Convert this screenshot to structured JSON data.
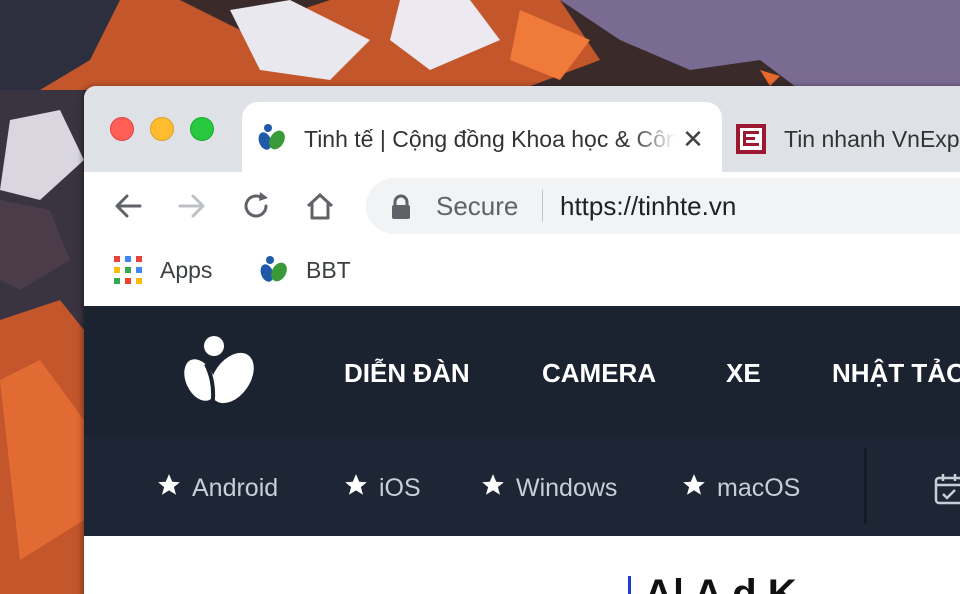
{
  "window": {
    "controls": [
      "close",
      "minimize",
      "maximize"
    ]
  },
  "tabs": [
    {
      "title": "Tinh tế | Cộng đồng Khoa học & Công nghệ",
      "active": true,
      "favicon": "tinhte-logo-icon"
    },
    {
      "title": "Tin nhanh VnExpress",
      "active": false,
      "favicon": "vnexpress-e-icon"
    }
  ],
  "toolbar": {
    "back": "arrow-left-icon",
    "forward": "arrow-right-icon",
    "reload": "reload-icon",
    "home": "home-icon",
    "secure_label": "Secure",
    "url": "https://tinhte.vn"
  },
  "bookmarks": [
    {
      "label": "Apps",
      "icon": "apps-grid-icon"
    },
    {
      "label": "BBT",
      "icon": "tinhte-logo-icon"
    }
  ],
  "site": {
    "nav": [
      "DIỄN ĐÀN",
      "CAMERA",
      "XE",
      "NHẬT TẢO"
    ],
    "subnav": [
      "Android",
      "iOS",
      "Windows",
      "macOS"
    ],
    "headline": "A| A   d   K"
  },
  "colors": {
    "site_header_bg": "#1b2331",
    "accent_bar": "#1a3cd1",
    "tab_bar_bg": "#dee1e6"
  }
}
